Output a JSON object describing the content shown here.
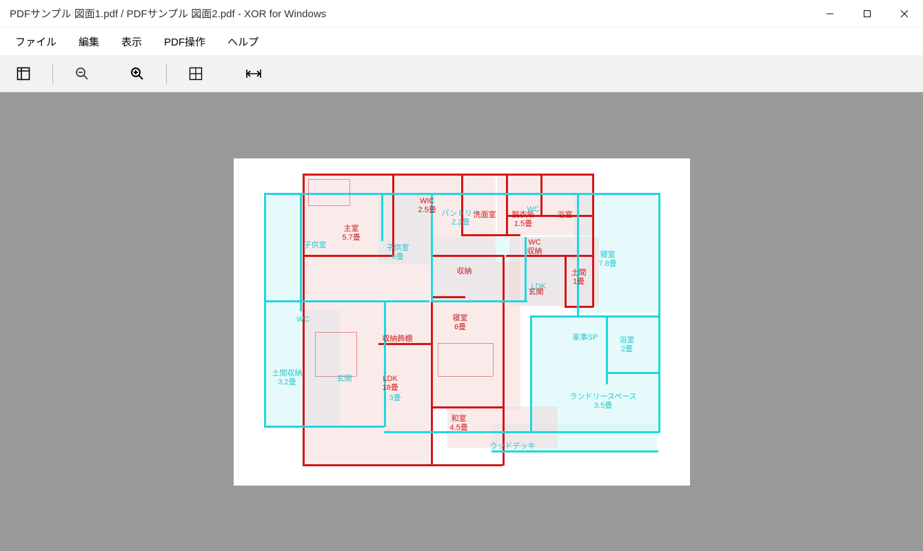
{
  "title": "PDFサンプル 図面1.pdf / PDFサンプル 図面2.pdf - XOR for Windows",
  "menu": {
    "file": "ファイル",
    "edit": "編集",
    "view": "表示",
    "pdf_ops": "PDF操作",
    "help": "ヘルプ"
  },
  "rooms": {
    "r_shushitsu": "主室\n5.7畳",
    "r_wic": "WIC\n2.5畳",
    "r_senmen": "洗面室",
    "r_datsui": "脱衣所\n1.5畳",
    "r_yokushitsu": "浴室",
    "r_wc": "WC\n収納",
    "r_shuno": "収納",
    "r_doma": "土間\n1畳",
    "r_genkan": "玄関",
    "r_shinshitsu": "寝室\n6畳",
    "r_ldk": "LDK\n18畳",
    "r_washitsu": "和室\n4.5畳",
    "r_shuno_shelf": "収納飾棚",
    "r_ldk_small": "LDK",
    "r_wc_small": "WC",
    "r_ldk_3jo": "3畳",
    "c_pantry": "パントリー\n2.2畳",
    "c_kodomo1": "子供室",
    "c_kodomo2": "子供室\n6畳",
    "c_shinshitsu": "寝室\n7.8畳",
    "c_genkan": "玄関",
    "c_doma_shuno": "土間収納\n3.2畳",
    "c_wc": "WC",
    "c_kajisp": "家事SP",
    "c_laundry": "ランドリースペース\n3.5畳",
    "c_ysk": "浴室\n2畳",
    "c_wooddeck": "ウッドデッキ"
  }
}
